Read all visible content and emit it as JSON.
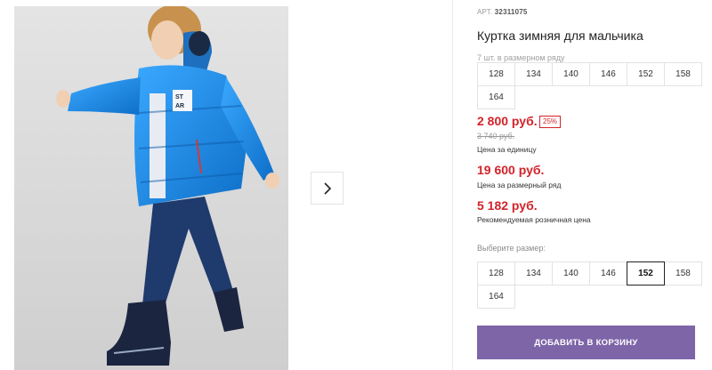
{
  "product": {
    "article_label": "АРТ.",
    "article_number": "32311075",
    "title": "Куртка зимняя для мальчика",
    "photo_alt": "Product photo: boy in blue winter jacket",
    "lot_note": "7 шт. в размерном ряду",
    "lot_sizes": [
      "128",
      "134",
      "140",
      "146",
      "152",
      "158",
      "164"
    ],
    "price": "2 800 руб.",
    "discount_badge": "25%",
    "old_price": "3 740 руб.",
    "price_caption": "Цена за единицу",
    "lot_price": "19 600 руб.",
    "lot_price_caption": "Цена за размерный ряд",
    "rrp_price": "5 182 руб.",
    "rrp_caption": "Рекомендуемая розничная цена",
    "choose_size_label": "Выберите размер:",
    "size_options": [
      "128",
      "134",
      "140",
      "146",
      "152",
      "158",
      "164"
    ],
    "selected_size": "152",
    "add_to_cart_label": "ДОБАВИТЬ В КОРЗИНУ"
  },
  "colors": {
    "price_red": "#d2232a",
    "button_purple": "#7e65a8",
    "jacket_blue": "#1e8fe6"
  },
  "icons": {
    "next": "chevron-right-icon"
  }
}
